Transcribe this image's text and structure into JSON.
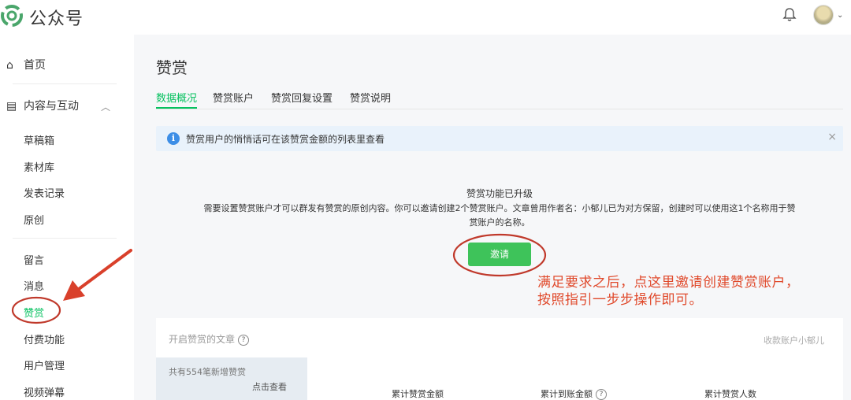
{
  "header": {
    "app_name": "公众号",
    "logo_icon": "wechat-official-accounts-logo-icon",
    "bell_icon": "bell-icon",
    "avatar_icon": "avatar"
  },
  "sidebar": {
    "home": "首页",
    "content_section": "内容与互动",
    "items": [
      {
        "label": "草稿箱"
      },
      {
        "label": "素材库"
      },
      {
        "label": "发表记录"
      },
      {
        "label": "原创"
      },
      {
        "label": "留言"
      },
      {
        "label": "消息"
      },
      {
        "label": "赞赏"
      },
      {
        "label": "付费功能"
      },
      {
        "label": "用户管理"
      },
      {
        "label": "视频弹幕"
      }
    ],
    "active": "赞赏"
  },
  "main": {
    "title": "赞赏",
    "tabs": [
      {
        "label": "数据概况"
      },
      {
        "label": "赞赏账户"
      },
      {
        "label": "赞赏回复设置"
      },
      {
        "label": "赞赏说明"
      }
    ],
    "notice": {
      "text": "赞赏用户的悄悄话可在该赞赏金额的列表里查看",
      "close": "×"
    },
    "upgrade": {
      "title": "赞赏功能已升级",
      "desc_line1": "需要设置赞赏账户才可以群发有赞赏的原创内容。你可以邀请创建2个赞赏账户。文章曾用作者名：小郁儿已为对方保留，创建时可以使用这1个名称用于赞",
      "desc_line2": "赏账户的名称。",
      "invite_button": "邀请"
    },
    "annotation": {
      "line1": "满足要求之后，点这里邀请创建赞赏账户，",
      "line2": "按照指引一步步操作即可。"
    },
    "articles": {
      "header": "开启赞赏的文章",
      "help": "?",
      "item_text": "共有554笔新增赞赏",
      "item_link": "点击查看"
    },
    "stats": {
      "account": "收款账户小郁儿",
      "total_amount": "累计赞赏金额",
      "total_received": "累计到账金额",
      "total_people": "累计赞赏人数",
      "help": "?"
    }
  },
  "colors": {
    "accent": "#07c160",
    "button": "#3ec35a",
    "annotation": "#e0492b",
    "notice_bg": "#e9f2fb",
    "info_icon": "#3d8ee6"
  }
}
